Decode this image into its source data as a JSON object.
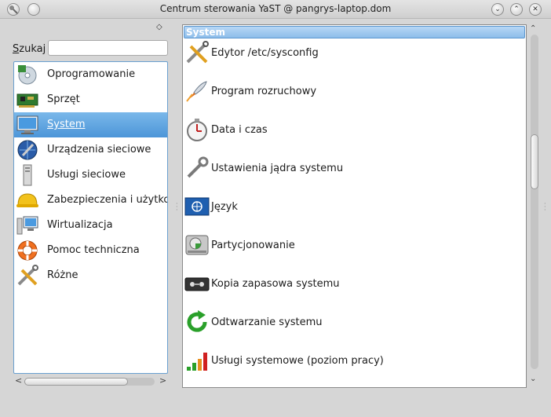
{
  "window": {
    "title": "Centrum sterowania YaST @ pangrys-laptop.dom",
    "buttons": {
      "menu_icon": "window-menu-icon",
      "pin_icon": "pin-icon",
      "minimize": "⌄",
      "maximize": "⌃",
      "close": "✕"
    }
  },
  "left_panel": {
    "pin": "◇",
    "search": {
      "label_accel": "S",
      "label_rest": "zukaj",
      "value": "",
      "placeholder": ""
    },
    "categories": [
      {
        "label": "Oprogramowanie",
        "icon": "software-cd-icon",
        "selected": false
      },
      {
        "label": "Sprzęt",
        "icon": "hardware-card-icon",
        "selected": false
      },
      {
        "label": "System",
        "icon": "monitor-icon",
        "selected": true
      },
      {
        "label": "Urządzenia sieciowe",
        "icon": "globe-wrench-icon",
        "selected": false
      },
      {
        "label": "Usługi sieciowe",
        "icon": "network-services-icon",
        "selected": false
      },
      {
        "label": "Zabezpieczenia i użytkownicy",
        "icon": "hardhat-icon",
        "selected": false
      },
      {
        "label": "Wirtualizacja",
        "icon": "virtualization-icon",
        "selected": false
      },
      {
        "label": "Pomoc techniczna",
        "icon": "lifebuoy-icon",
        "selected": false
      },
      {
        "label": "Różne",
        "icon": "tools-icon",
        "selected": false
      }
    ],
    "hscroll": {
      "left_arrow": "<",
      "right_arrow": ">"
    }
  },
  "right_panel": {
    "section_title": "System",
    "modules": [
      {
        "label": "Edytor /etc/sysconfig",
        "icon": "tools-icon"
      },
      {
        "label": "Program rozruchowy",
        "icon": "rocket-icon"
      },
      {
        "label": "Data i czas",
        "icon": "stopwatch-icon"
      },
      {
        "label": "Ustawienia jądra systemu",
        "icon": "wrench-icon"
      },
      {
        "label": "Język",
        "icon": "un-flag-icon"
      },
      {
        "label": "Partycjonowanie",
        "icon": "hard-disk-icon"
      },
      {
        "label": "Kopia zapasowa systemu",
        "icon": "tape-icon"
      },
      {
        "label": "Odtwarzanie systemu",
        "icon": "restore-arrow-icon"
      },
      {
        "label": "Usługi systemowe (poziom pracy)",
        "icon": "runlevel-bars-icon"
      }
    ],
    "vscroll": {
      "up_arrow": "⌃",
      "down_arrow": "⌄"
    }
  },
  "colors": {
    "selection": "#4c95d8",
    "section_header": "#8dbdea",
    "window_bg": "#d6d6d6"
  }
}
